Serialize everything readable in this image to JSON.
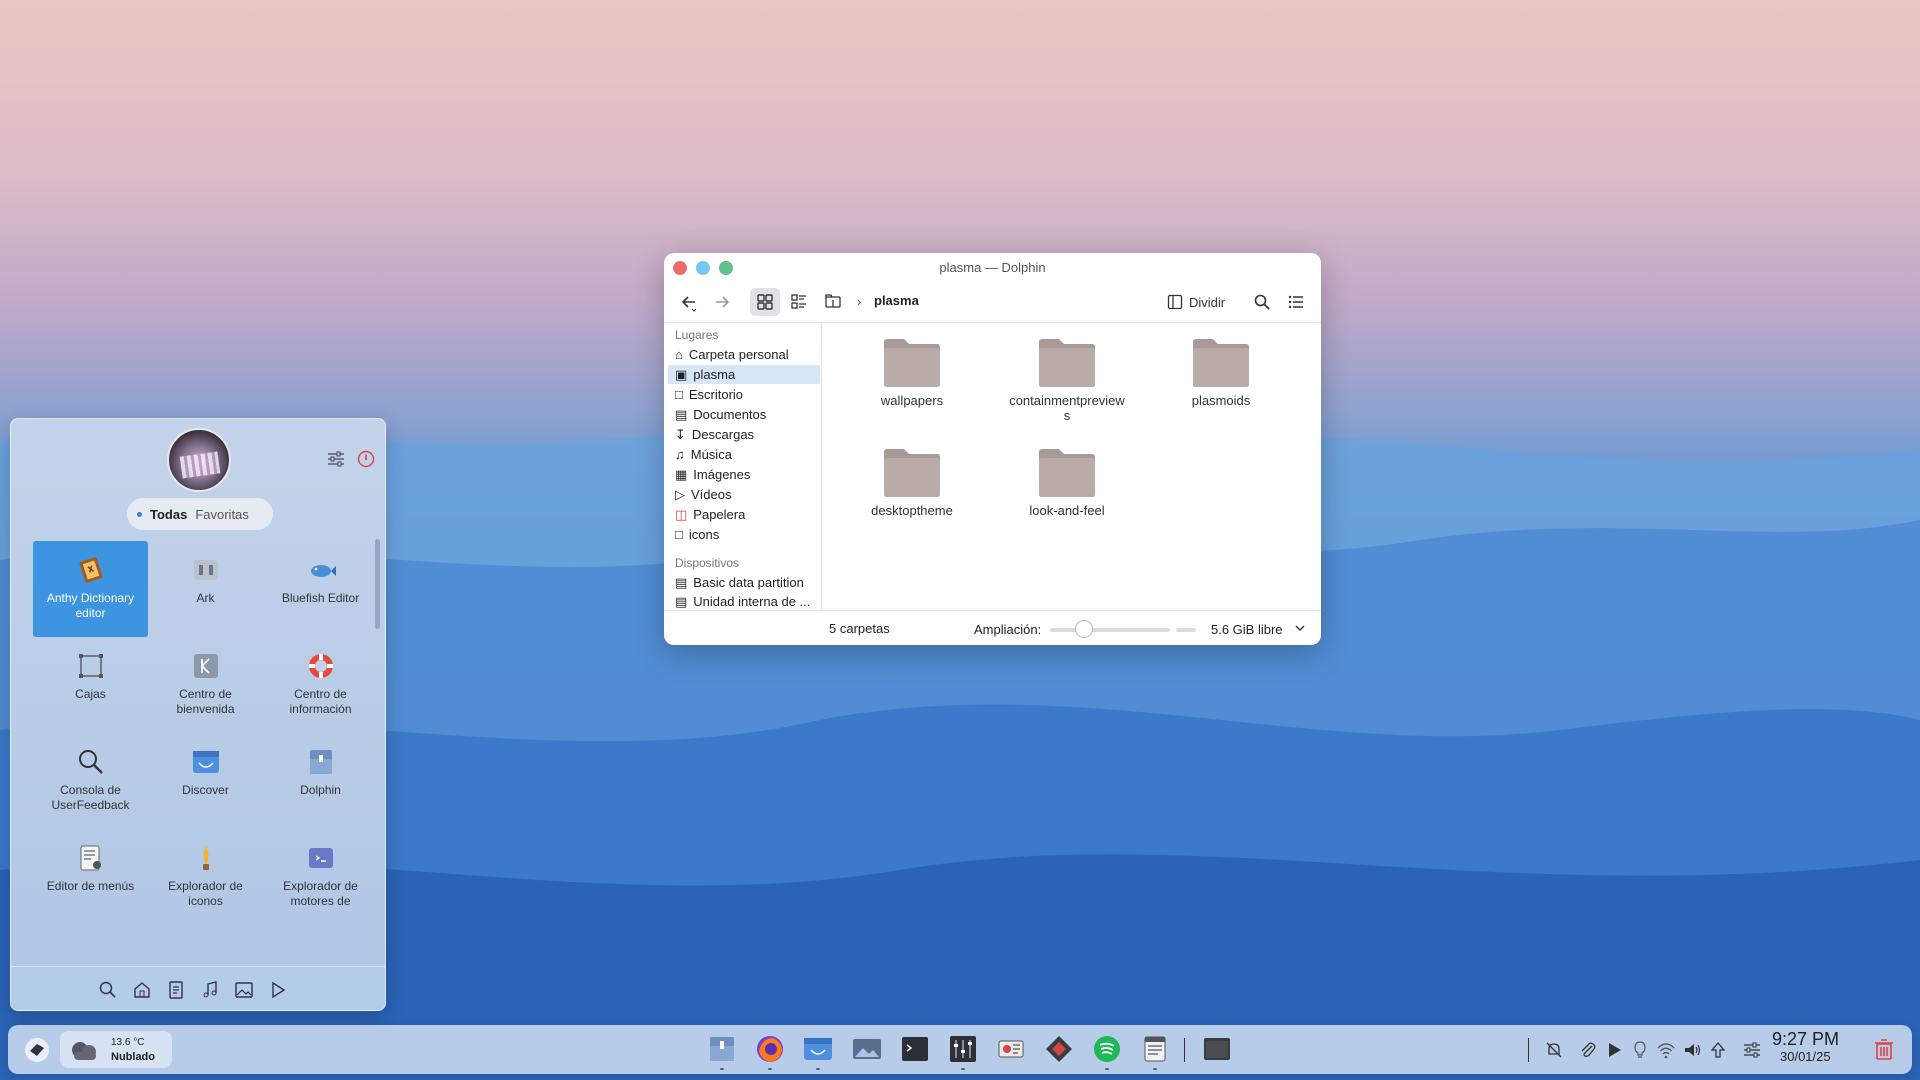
{
  "dolphin": {
    "title": "plasma — Dolphin",
    "breadcrumb": "plasma",
    "split_label": "Dividir",
    "sidebar": {
      "places_header": "Lugares",
      "places": [
        {
          "label": "Carpeta personal",
          "icon": "home-icon"
        },
        {
          "label": "plasma",
          "icon": "folder-icon",
          "selected": true
        },
        {
          "label": "Escritorio",
          "icon": "desktop-icon"
        },
        {
          "label": "Documentos",
          "icon": "document-icon"
        },
        {
          "label": "Descargas",
          "icon": "download-icon"
        },
        {
          "label": "Música",
          "icon": "music-icon"
        },
        {
          "label": "Imágenes",
          "icon": "image-icon"
        },
        {
          "label": "Vídeos",
          "icon": "video-icon"
        },
        {
          "label": "Papelera",
          "icon": "trash-icon"
        },
        {
          "label": "icons",
          "icon": "folder-icon"
        }
      ],
      "devices_header": "Dispositivos",
      "devices": [
        {
          "label": "Basic data partition",
          "icon": "drive-icon"
        },
        {
          "label": "Unidad interna de ...",
          "icon": "drive-icon"
        }
      ]
    },
    "files": [
      {
        "name": "wallpapers"
      },
      {
        "name": "containmentpreviews"
      },
      {
        "name": "plasmoids"
      },
      {
        "name": "desktoptheme"
      },
      {
        "name": "look-and-feel"
      }
    ],
    "status": {
      "count": "5 carpetas",
      "zoom_label": "Ampliación:",
      "zoom_level": 0.2,
      "free_space": "5.6 GiB libre"
    }
  },
  "launcher": {
    "tabs": {
      "active": "Todas",
      "other": "Favoritas"
    },
    "apps": [
      {
        "label": "Anthy Dictionary editor",
        "icon": "dictionary-icon",
        "selected": true
      },
      {
        "label": "Ark",
        "icon": "archive-icon"
      },
      {
        "label": "Bluefish Editor",
        "icon": "bluefish-icon"
      },
      {
        "label": "Cajas",
        "icon": "boxes-icon"
      },
      {
        "label": "Centro de bienvenida",
        "icon": "welcome-icon"
      },
      {
        "label": "Centro de información",
        "icon": "lifebuoy-icon"
      },
      {
        "label": "Consola de UserFeedback",
        "icon": "magnifier-icon"
      },
      {
        "label": "Discover",
        "icon": "discover-icon"
      },
      {
        "label": "Dolphin",
        "icon": "dolphin-icon"
      },
      {
        "label": "Editor de menús",
        "icon": "menu-editor-icon"
      },
      {
        "label": "Explorador de iconos",
        "icon": "icon-explorer-icon"
      },
      {
        "label": "Explorador de motores de",
        "icon": "engine-explorer-icon"
      }
    ],
    "bottom_icons": [
      "search-icon",
      "home-icon",
      "document-icon",
      "music-icon",
      "image-icon",
      "video-icon"
    ]
  },
  "panel": {
    "weather": {
      "temp": "13.6 °C",
      "condition": "Nublado"
    },
    "tasks": [
      "dolphin-task",
      "firefox-task",
      "discover-task",
      "gwenview-task",
      "konsole-task",
      "mixer-task",
      "disk-usage-task",
      "kate-task",
      "spotify-task",
      "notes-task",
      "window-task"
    ],
    "clock": {
      "time": "9:27 PM",
      "date": "30/01/25"
    }
  },
  "colors": {
    "accent": "#3d94e0",
    "close": "#ee6b6b",
    "minimize": "#75c9ee",
    "maximize": "#5dc28d",
    "folder": "#b8aaa6",
    "trash_red": "#e0413f"
  }
}
